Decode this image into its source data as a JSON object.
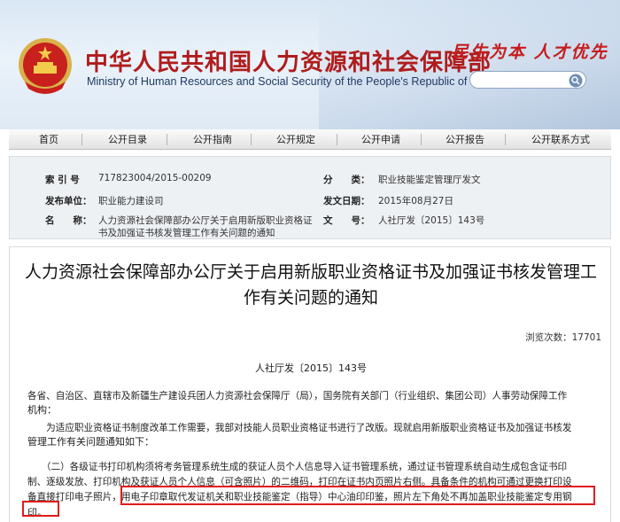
{
  "header": {
    "title_cn": "中华人民共和国人力资源和社会保障部",
    "title_en": "Ministry of Human Resources and Social Security of the People's Republic of China",
    "slogan": "民生为本 人才优先",
    "search": {
      "placeholder": ""
    }
  },
  "nav": {
    "items": [
      {
        "label": "首页"
      },
      {
        "label": "公开目录"
      },
      {
        "label": "公开指南"
      },
      {
        "label": "公开规定"
      },
      {
        "label": "公开申请"
      },
      {
        "label": "公开报告"
      },
      {
        "label": "公开联系方式"
      }
    ]
  },
  "meta": {
    "index_label": "索 引 号",
    "index_value": "717823004/2015-00209",
    "category_label": "分　　类：",
    "category_value": "职业技能鉴定管理厅发文",
    "issuer_label": "发布单位：",
    "issuer_value": "职业能力建设司",
    "date_label": "发文日期：",
    "date_value": "2015年08月27日",
    "name_label": "名　　称：",
    "name_value_1": "人力资源社会保障部办公厅关于启用新版职业资格证",
    "name_value_2": "书及加强证书核发管理工作有关问题的通知",
    "docno_label": "文　　号：",
    "docno_value": "人社厅发〔2015〕143号"
  },
  "article": {
    "title_line1": "人力资源社会保障部办公厅关于启用新版职业资格证书及加强证书核发管理工",
    "title_line2": "作有关问题的通知",
    "views": "浏览次数：17701",
    "docno": "人社厅发〔2015〕143号",
    "p1_l1": "各省、自治区、直辖市及新疆生产建设兵团人力资源社会保障厅（局），国务院有关部门（行业组织、集团公司）人事劳动保障工作",
    "p1_l2": "机构：",
    "p2_l1": "　　为适应职业资格证书制度改革工作需要，我部对技能人员职业资格证书进行了改版。现就启用新版职业资格证书及加强证书核发",
    "p2_l2": "管理工作有关问题通知如下：",
    "p3_l1": "　　（二）各级证书打印机构须将考务管理系统生成的获证人员个人信息导入证书管理系统，通过证书管理系统自动生成包含证书印",
    "p3_l2": "制、逐级发放、打印机构及获证人员个人信息（可含照片）的二维码，打印在证书内页照片右侧。具备条件的机构可通过更换打印设",
    "p3_l3a": "备直接打印电子照片，",
    "p3_l3b": "用电子印章取代发证机关和职业技能鉴定（指导）中心油印印鉴，照片左下角处不再加盖职业技能鉴定专用钢",
    "p3_l4": "印。"
  }
}
